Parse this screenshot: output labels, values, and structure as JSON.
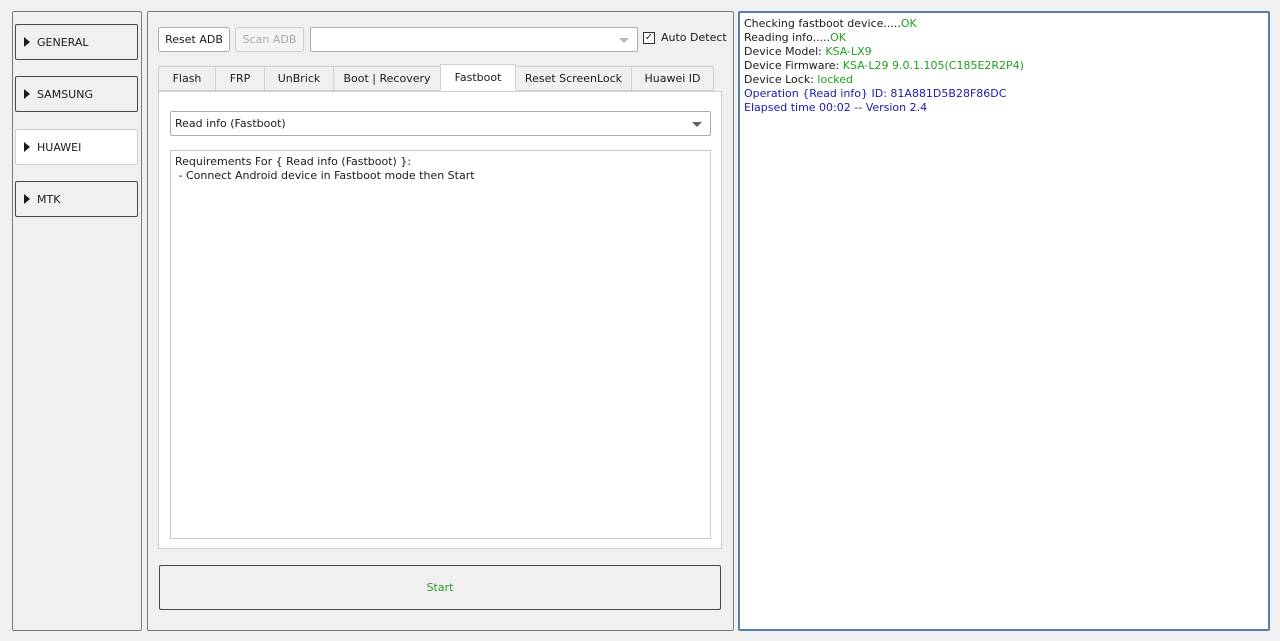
{
  "sidebar": {
    "items": [
      {
        "label": "GENERAL",
        "active": false
      },
      {
        "label": "SAMSUNG",
        "active": false
      },
      {
        "label": "HUAWEI",
        "active": true
      },
      {
        "label": "MTK",
        "active": false
      }
    ]
  },
  "toolbar": {
    "reset_adb_label": "Reset ADB",
    "scan_adb_label": "Scan ADB",
    "device_select_value": "",
    "auto_detect_label": "Auto Detect",
    "auto_detect_checked": true
  },
  "tabs": [
    {
      "label": "Flash",
      "active": false
    },
    {
      "label": "FRP",
      "active": false
    },
    {
      "label": "UnBrick",
      "active": false
    },
    {
      "label": "Boot | Recovery",
      "active": false
    },
    {
      "label": "Fastboot",
      "active": true
    },
    {
      "label": "Reset ScreenLock",
      "active": false
    },
    {
      "label": "Huawei ID",
      "active": false
    }
  ],
  "fastboot": {
    "operation_value": "Read info (Fastboot)",
    "requirements_title": "Requirements For { Read info (Fastboot) }:",
    "requirements_line": " - Connect Android device in Fastboot mode then Start"
  },
  "start_label": "Start",
  "log": {
    "l1_label": "Checking fastboot device.....",
    "l1_value": "OK",
    "l2_label": "Reading info.....",
    "l2_value": "OK",
    "l3_label": "Device Model: ",
    "l3_value": "KSA-LX9",
    "l4_label": "Device Firmware: ",
    "l4_value": "KSA-L29 9.0.1.105(C185E2R2P4)",
    "l5_label": "Device Lock: ",
    "l5_value": "locked",
    "l6_label": "Operation {Read info} ",
    "l6_value": "ID: 81A881D5B28F86DC",
    "l7": "Elapsed time 00:02 -- Version 2.4"
  },
  "colors": {
    "ok_green": "#1ea01e",
    "info_blue": "#1a1ab0",
    "log_border": "#5a7fa6"
  },
  "icons": {
    "sidebar_expand": "triangle-right-icon",
    "dropdown": "chevron-down-icon",
    "checkbox": "checkmark-icon"
  }
}
